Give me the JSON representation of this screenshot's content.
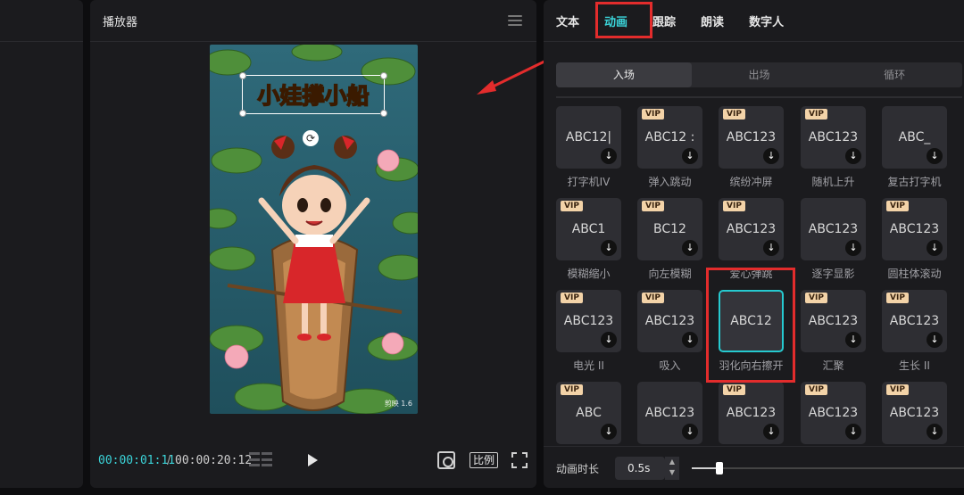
{
  "player": {
    "title": "播放器",
    "caption": "小娃撑小船",
    "watermark": "剪映 1.6",
    "time_current": "00:00:01:11",
    "time_separator": "/",
    "time_total": "00:00:20:12",
    "ratio_label": "比例"
  },
  "panel": {
    "tabs": [
      {
        "label": "文本"
      },
      {
        "label": "动画"
      },
      {
        "label": "跟踪"
      },
      {
        "label": "朗读"
      },
      {
        "label": "数字人"
      }
    ],
    "active_tab": "动画",
    "subtabs": [
      {
        "label": "入场"
      },
      {
        "label": "出场"
      },
      {
        "label": "循环"
      }
    ],
    "active_subtab": "入场",
    "vip_label": "VIP",
    "animations": [
      {
        "label": "打字机IV",
        "preview": "ABC12|",
        "vip": false
      },
      {
        "label": "弹入跳动",
        "preview": "ABC12 :",
        "vip": true
      },
      {
        "label": "缤纷冲屏",
        "preview": "ABC123",
        "vip": true
      },
      {
        "label": "随机上升",
        "preview": "ABC123",
        "vip": true
      },
      {
        "label": "复古打字机",
        "preview": "ABC_",
        "vip": false
      },
      {
        "label": "模糊缩小",
        "preview": "ABC1",
        "vip": true
      },
      {
        "label": "向左模糊",
        "preview": "BC12",
        "vip": true
      },
      {
        "label": "爱心弹跳",
        "preview": "ABC123",
        "vip": true
      },
      {
        "label": "逐字显影",
        "preview": "ABC123",
        "vip": false
      },
      {
        "label": "圆柱体滚动",
        "preview": "ABC123",
        "vip": true
      },
      {
        "label": "电光 II",
        "preview": "ABC123",
        "vip": true
      },
      {
        "label": "吸入",
        "preview": "ABC123",
        "vip": true
      },
      {
        "label": "羽化向右擦开",
        "preview": "ABC12",
        "vip": false,
        "selected": true
      },
      {
        "label": "汇聚",
        "preview": "ABC123",
        "vip": true
      },
      {
        "label": "生长 II",
        "preview": "ABC123",
        "vip": true
      },
      {
        "label": "",
        "preview": "ABC",
        "vip": true
      },
      {
        "label": "",
        "preview": "ABC123",
        "vip": false
      },
      {
        "label": "",
        "preview": "ABC123",
        "vip": true
      },
      {
        "label": "",
        "preview": "ABC123",
        "vip": true
      },
      {
        "label": "",
        "preview": "ABC123",
        "vip": true
      }
    ],
    "duration_label": "动画时长",
    "duration_value": "0.5s",
    "duration_fraction": 0.1
  },
  "colors": {
    "accent": "#3bd4d9",
    "highlight_red": "#e32c2c",
    "vip_badge": "#f3d3a8"
  }
}
